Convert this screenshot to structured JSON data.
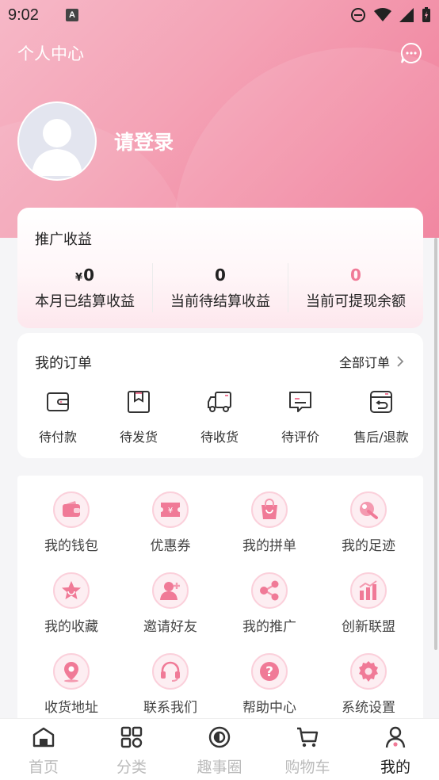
{
  "status_bar": {
    "time": "9:02",
    "notif_glyph": "A"
  },
  "header": {
    "title": "个人中心",
    "message_icon": "chat-bubble-icon"
  },
  "profile": {
    "login_text": "请登录",
    "avatar_icon": "default-avatar"
  },
  "promotion": {
    "title": "推广收益",
    "currency_symbol": "¥",
    "stats": [
      {
        "value": "0",
        "label": "本月已结算收益"
      },
      {
        "value": "0",
        "label": "当前待结算收益"
      },
      {
        "value": "0",
        "label": "当前可提现余额"
      }
    ],
    "highlight_color": "#f07a97"
  },
  "orders": {
    "title": "我的订单",
    "all_label": "全部订单",
    "items": [
      {
        "label": "待付款",
        "icon": "wallet-icon"
      },
      {
        "label": "待发货",
        "icon": "box-icon"
      },
      {
        "label": "待收货",
        "icon": "truck-icon"
      },
      {
        "label": "待评价",
        "icon": "comment-icon"
      },
      {
        "label": "售后/退款",
        "icon": "return-icon"
      }
    ]
  },
  "services": [
    {
      "label": "我的钱包",
      "icon": "wallet-icon"
    },
    {
      "label": "优惠券",
      "icon": "coupon-icon"
    },
    {
      "label": "我的拼单",
      "icon": "shopping-bag-icon"
    },
    {
      "label": "我的足迹",
      "icon": "footprint-icon"
    },
    {
      "label": "我的收藏",
      "icon": "star-icon"
    },
    {
      "label": "邀请好友",
      "icon": "add-user-icon"
    },
    {
      "label": "我的推广",
      "icon": "share-icon"
    },
    {
      "label": "创新联盟",
      "icon": "bar-chart-icon"
    },
    {
      "label": "收货地址",
      "icon": "location-icon"
    },
    {
      "label": "联系我们",
      "icon": "headset-icon"
    },
    {
      "label": "帮助中心",
      "icon": "help-icon"
    },
    {
      "label": "系统设置",
      "icon": "gear-icon"
    }
  ],
  "tabbar": {
    "items": [
      {
        "label": "首页",
        "icon": "home-icon",
        "active": false
      },
      {
        "label": "分类",
        "icon": "category-icon",
        "active": false
      },
      {
        "label": "趣事圈",
        "icon": "circle-icon",
        "active": false
      },
      {
        "label": "购物车",
        "icon": "cart-icon",
        "active": false
      },
      {
        "label": "我的",
        "icon": "person-icon",
        "active": true
      }
    ]
  },
  "colors": {
    "accent": "#f07a97",
    "hero_start": "#f6b8c7",
    "hero_end": "#f07a97"
  }
}
